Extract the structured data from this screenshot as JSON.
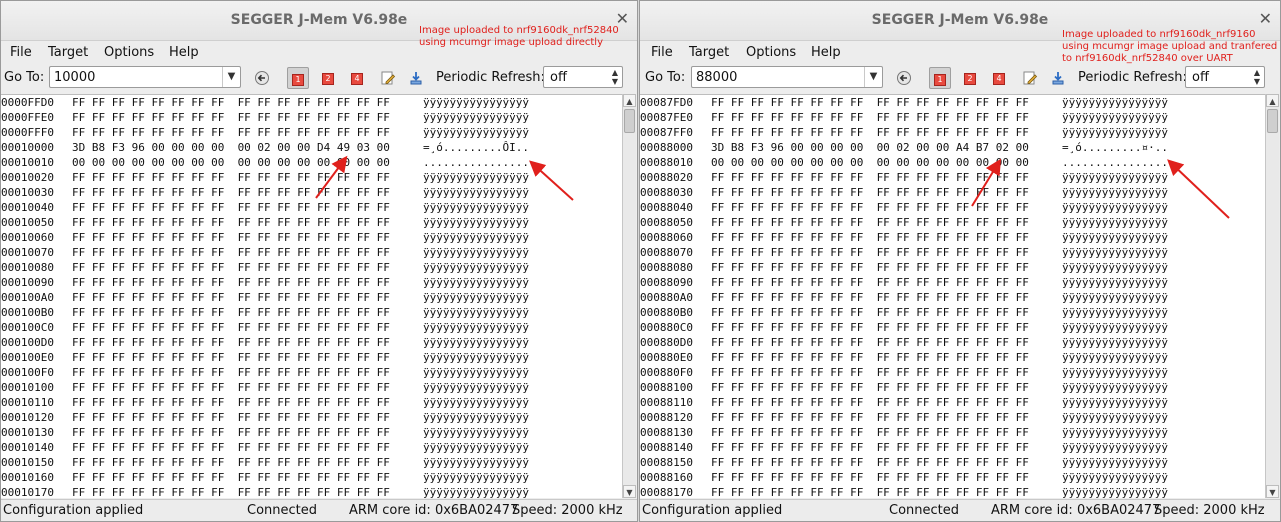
{
  "windows": [
    {
      "title": "SEGGER J-Mem V6.98e",
      "close_glyph": "✕",
      "note": "Image uploaded to nrf9160dk_nrf52840\nusing mcumgr image upload directly",
      "menu": [
        "File",
        "Target",
        "Options",
        "Help"
      ],
      "goto_label": "Go To:",
      "goto_value": "10000",
      "refresh_label": "Periodic Refresh:",
      "refresh_value": "off",
      "rows": [
        {
          "addr": "0000FFD0",
          "bytes": "FF FF FF FF FF FF FF FF  FF FF FF FF FF FF FF FF",
          "ascii": "ÿÿÿÿÿÿÿÿÿÿÿÿÿÿÿÿ"
        },
        {
          "addr": "0000FFE0",
          "bytes": "FF FF FF FF FF FF FF FF  FF FF FF FF FF FF FF FF",
          "ascii": "ÿÿÿÿÿÿÿÿÿÿÿÿÿÿÿÿ"
        },
        {
          "addr": "0000FFF0",
          "bytes": "FF FF FF FF FF FF FF FF  FF FF FF FF FF FF FF FF",
          "ascii": "ÿÿÿÿÿÿÿÿÿÿÿÿÿÿÿÿ"
        },
        {
          "addr": "00010000",
          "bytes": "3D B8 F3 96 00 00 00 00  00 02 00 00 D4 49 03 00",
          "ascii": "=¸ó.........ÔI.."
        },
        {
          "addr": "00010010",
          "bytes": "00 00 00 00 00 00 00 00  00 00 00 00 00 00 00 00",
          "ascii": "................"
        },
        {
          "addr": "00010020",
          "bytes": "FF FF FF FF FF FF FF FF  FF FF FF FF FF FF FF FF",
          "ascii": "ÿÿÿÿÿÿÿÿÿÿÿÿÿÿÿÿ"
        },
        {
          "addr": "00010030",
          "bytes": "FF FF FF FF FF FF FF FF  FF FF FF FF FF FF FF FF",
          "ascii": "ÿÿÿÿÿÿÿÿÿÿÿÿÿÿÿÿ"
        },
        {
          "addr": "00010040",
          "bytes": "FF FF FF FF FF FF FF FF  FF FF FF FF FF FF FF FF",
          "ascii": "ÿÿÿÿÿÿÿÿÿÿÿÿÿÿÿÿ"
        },
        {
          "addr": "00010050",
          "bytes": "FF FF FF FF FF FF FF FF  FF FF FF FF FF FF FF FF",
          "ascii": "ÿÿÿÿÿÿÿÿÿÿÿÿÿÿÿÿ"
        },
        {
          "addr": "00010060",
          "bytes": "FF FF FF FF FF FF FF FF  FF FF FF FF FF FF FF FF",
          "ascii": "ÿÿÿÿÿÿÿÿÿÿÿÿÿÿÿÿ"
        },
        {
          "addr": "00010070",
          "bytes": "FF FF FF FF FF FF FF FF  FF FF FF FF FF FF FF FF",
          "ascii": "ÿÿÿÿÿÿÿÿÿÿÿÿÿÿÿÿ"
        },
        {
          "addr": "00010080",
          "bytes": "FF FF FF FF FF FF FF FF  FF FF FF FF FF FF FF FF",
          "ascii": "ÿÿÿÿÿÿÿÿÿÿÿÿÿÿÿÿ"
        },
        {
          "addr": "00010090",
          "bytes": "FF FF FF FF FF FF FF FF  FF FF FF FF FF FF FF FF",
          "ascii": "ÿÿÿÿÿÿÿÿÿÿÿÿÿÿÿÿ"
        },
        {
          "addr": "000100A0",
          "bytes": "FF FF FF FF FF FF FF FF  FF FF FF FF FF FF FF FF",
          "ascii": "ÿÿÿÿÿÿÿÿÿÿÿÿÿÿÿÿ"
        },
        {
          "addr": "000100B0",
          "bytes": "FF FF FF FF FF FF FF FF  FF FF FF FF FF FF FF FF",
          "ascii": "ÿÿÿÿÿÿÿÿÿÿÿÿÿÿÿÿ"
        },
        {
          "addr": "000100C0",
          "bytes": "FF FF FF FF FF FF FF FF  FF FF FF FF FF FF FF FF",
          "ascii": "ÿÿÿÿÿÿÿÿÿÿÿÿÿÿÿÿ"
        },
        {
          "addr": "000100D0",
          "bytes": "FF FF FF FF FF FF FF FF  FF FF FF FF FF FF FF FF",
          "ascii": "ÿÿÿÿÿÿÿÿÿÿÿÿÿÿÿÿ"
        },
        {
          "addr": "000100E0",
          "bytes": "FF FF FF FF FF FF FF FF  FF FF FF FF FF FF FF FF",
          "ascii": "ÿÿÿÿÿÿÿÿÿÿÿÿÿÿÿÿ"
        },
        {
          "addr": "000100F0",
          "bytes": "FF FF FF FF FF FF FF FF  FF FF FF FF FF FF FF FF",
          "ascii": "ÿÿÿÿÿÿÿÿÿÿÿÿÿÿÿÿ"
        },
        {
          "addr": "00010100",
          "bytes": "FF FF FF FF FF FF FF FF  FF FF FF FF FF FF FF FF",
          "ascii": "ÿÿÿÿÿÿÿÿÿÿÿÿÿÿÿÿ"
        },
        {
          "addr": "00010110",
          "bytes": "FF FF FF FF FF FF FF FF  FF FF FF FF FF FF FF FF",
          "ascii": "ÿÿÿÿÿÿÿÿÿÿÿÿÿÿÿÿ"
        },
        {
          "addr": "00010120",
          "bytes": "FF FF FF FF FF FF FF FF  FF FF FF FF FF FF FF FF",
          "ascii": "ÿÿÿÿÿÿÿÿÿÿÿÿÿÿÿÿ"
        },
        {
          "addr": "00010130",
          "bytes": "FF FF FF FF FF FF FF FF  FF FF FF FF FF FF FF FF",
          "ascii": "ÿÿÿÿÿÿÿÿÿÿÿÿÿÿÿÿ"
        },
        {
          "addr": "00010140",
          "bytes": "FF FF FF FF FF FF FF FF  FF FF FF FF FF FF FF FF",
          "ascii": "ÿÿÿÿÿÿÿÿÿÿÿÿÿÿÿÿ"
        },
        {
          "addr": "00010150",
          "bytes": "FF FF FF FF FF FF FF FF  FF FF FF FF FF FF FF FF",
          "ascii": "ÿÿÿÿÿÿÿÿÿÿÿÿÿÿÿÿ"
        },
        {
          "addr": "00010160",
          "bytes": "FF FF FF FF FF FF FF FF  FF FF FF FF FF FF FF FF",
          "ascii": "ÿÿÿÿÿÿÿÿÿÿÿÿÿÿÿÿ"
        },
        {
          "addr": "00010170",
          "bytes": "FF FF FF FF FF FF FF FF  FF FF FF FF FF FF FF FF",
          "ascii": "ÿÿÿÿÿÿÿÿÿÿÿÿÿÿÿÿ"
        }
      ],
      "status": {
        "message": "Configuration applied",
        "connection": "Connected",
        "core": "ARM core id: 0x6BA02477",
        "speed": "Speed: 2000 kHz"
      }
    },
    {
      "title": "SEGGER J-Mem V6.98e",
      "close_glyph": "✕",
      "note": "Image uploaded to nrf9160dk_nrf9160\nusing mcumgr image upload and tranfered\nto nrf9160dk_nrf52840 over UART",
      "menu": [
        "File",
        "Target",
        "Options",
        "Help"
      ],
      "goto_label": "Go To:",
      "goto_value": "88000",
      "refresh_label": "Periodic Refresh:",
      "refresh_value": "off",
      "rows": [
        {
          "addr": "00087FD0",
          "bytes": "FF FF FF FF FF FF FF FF  FF FF FF FF FF FF FF FF",
          "ascii": "ÿÿÿÿÿÿÿÿÿÿÿÿÿÿÿÿ"
        },
        {
          "addr": "00087FE0",
          "bytes": "FF FF FF FF FF FF FF FF  FF FF FF FF FF FF FF FF",
          "ascii": "ÿÿÿÿÿÿÿÿÿÿÿÿÿÿÿÿ"
        },
        {
          "addr": "00087FF0",
          "bytes": "FF FF FF FF FF FF FF FF  FF FF FF FF FF FF FF FF",
          "ascii": "ÿÿÿÿÿÿÿÿÿÿÿÿÿÿÿÿ"
        },
        {
          "addr": "00088000",
          "bytes": "3D B8 F3 96 00 00 00 00  00 02 00 00 A4 B7 02 00",
          "ascii": "=¸ó.........¤·.."
        },
        {
          "addr": "00088010",
          "bytes": "00 00 00 00 00 00 00 00  00 00 00 00 00 00 00 00",
          "ascii": "................"
        },
        {
          "addr": "00088020",
          "bytes": "FF FF FF FF FF FF FF FF  FF FF FF FF FF FF FF FF",
          "ascii": "ÿÿÿÿÿÿÿÿÿÿÿÿÿÿÿÿ"
        },
        {
          "addr": "00088030",
          "bytes": "FF FF FF FF FF FF FF FF  FF FF FF FF FF FF FF FF",
          "ascii": "ÿÿÿÿÿÿÿÿÿÿÿÿÿÿÿÿ"
        },
        {
          "addr": "00088040",
          "bytes": "FF FF FF FF FF FF FF FF  FF FF FF FF FF FF FF FF",
          "ascii": "ÿÿÿÿÿÿÿÿÿÿÿÿÿÿÿÿ"
        },
        {
          "addr": "00088050",
          "bytes": "FF FF FF FF FF FF FF FF  FF FF FF FF FF FF FF FF",
          "ascii": "ÿÿÿÿÿÿÿÿÿÿÿÿÿÿÿÿ"
        },
        {
          "addr": "00088060",
          "bytes": "FF FF FF FF FF FF FF FF  FF FF FF FF FF FF FF FF",
          "ascii": "ÿÿÿÿÿÿÿÿÿÿÿÿÿÿÿÿ"
        },
        {
          "addr": "00088070",
          "bytes": "FF FF FF FF FF FF FF FF  FF FF FF FF FF FF FF FF",
          "ascii": "ÿÿÿÿÿÿÿÿÿÿÿÿÿÿÿÿ"
        },
        {
          "addr": "00088080",
          "bytes": "FF FF FF FF FF FF FF FF  FF FF FF FF FF FF FF FF",
          "ascii": "ÿÿÿÿÿÿÿÿÿÿÿÿÿÿÿÿ"
        },
        {
          "addr": "00088090",
          "bytes": "FF FF FF FF FF FF FF FF  FF FF FF FF FF FF FF FF",
          "ascii": "ÿÿÿÿÿÿÿÿÿÿÿÿÿÿÿÿ"
        },
        {
          "addr": "000880A0",
          "bytes": "FF FF FF FF FF FF FF FF  FF FF FF FF FF FF FF FF",
          "ascii": "ÿÿÿÿÿÿÿÿÿÿÿÿÿÿÿÿ"
        },
        {
          "addr": "000880B0",
          "bytes": "FF FF FF FF FF FF FF FF  FF FF FF FF FF FF FF FF",
          "ascii": "ÿÿÿÿÿÿÿÿÿÿÿÿÿÿÿÿ"
        },
        {
          "addr": "000880C0",
          "bytes": "FF FF FF FF FF FF FF FF  FF FF FF FF FF FF FF FF",
          "ascii": "ÿÿÿÿÿÿÿÿÿÿÿÿÿÿÿÿ"
        },
        {
          "addr": "000880D0",
          "bytes": "FF FF FF FF FF FF FF FF  FF FF FF FF FF FF FF FF",
          "ascii": "ÿÿÿÿÿÿÿÿÿÿÿÿÿÿÿÿ"
        },
        {
          "addr": "000880E0",
          "bytes": "FF FF FF FF FF FF FF FF  FF FF FF FF FF FF FF FF",
          "ascii": "ÿÿÿÿÿÿÿÿÿÿÿÿÿÿÿÿ"
        },
        {
          "addr": "000880F0",
          "bytes": "FF FF FF FF FF FF FF FF  FF FF FF FF FF FF FF FF",
          "ascii": "ÿÿÿÿÿÿÿÿÿÿÿÿÿÿÿÿ"
        },
        {
          "addr": "00088100",
          "bytes": "FF FF FF FF FF FF FF FF  FF FF FF FF FF FF FF FF",
          "ascii": "ÿÿÿÿÿÿÿÿÿÿÿÿÿÿÿÿ"
        },
        {
          "addr": "00088110",
          "bytes": "FF FF FF FF FF FF FF FF  FF FF FF FF FF FF FF FF",
          "ascii": "ÿÿÿÿÿÿÿÿÿÿÿÿÿÿÿÿ"
        },
        {
          "addr": "00088120",
          "bytes": "FF FF FF FF FF FF FF FF  FF FF FF FF FF FF FF FF",
          "ascii": "ÿÿÿÿÿÿÿÿÿÿÿÿÿÿÿÿ"
        },
        {
          "addr": "00088130",
          "bytes": "FF FF FF FF FF FF FF FF  FF FF FF FF FF FF FF FF",
          "ascii": "ÿÿÿÿÿÿÿÿÿÿÿÿÿÿÿÿ"
        },
        {
          "addr": "00088140",
          "bytes": "FF FF FF FF FF FF FF FF  FF FF FF FF FF FF FF FF",
          "ascii": "ÿÿÿÿÿÿÿÿÿÿÿÿÿÿÿÿ"
        },
        {
          "addr": "00088150",
          "bytes": "FF FF FF FF FF FF FF FF  FF FF FF FF FF FF FF FF",
          "ascii": "ÿÿÿÿÿÿÿÿÿÿÿÿÿÿÿÿ"
        },
        {
          "addr": "00088160",
          "bytes": "FF FF FF FF FF FF FF FF  FF FF FF FF FF FF FF FF",
          "ascii": "ÿÿÿÿÿÿÿÿÿÿÿÿÿÿÿÿ"
        },
        {
          "addr": "00088170",
          "bytes": "FF FF FF FF FF FF FF FF  FF FF FF FF FF FF FF FF",
          "ascii": "ÿÿÿÿÿÿÿÿÿÿÿÿÿÿÿÿ"
        }
      ],
      "status": {
        "message": "Configuration applied",
        "connection": "Connected",
        "core": "ARM core id: 0x6BA02477",
        "speed": "Speed: 2000 kHz"
      }
    }
  ],
  "icons": {
    "back": "back-arrow-icon",
    "ram1": "memory-1-icon",
    "ram2": "memory-2-icon",
    "ram4": "memory-4-icon",
    "edit": "edit-icon",
    "download": "download-icon"
  },
  "colors": {
    "annotation": "#e0201c"
  }
}
